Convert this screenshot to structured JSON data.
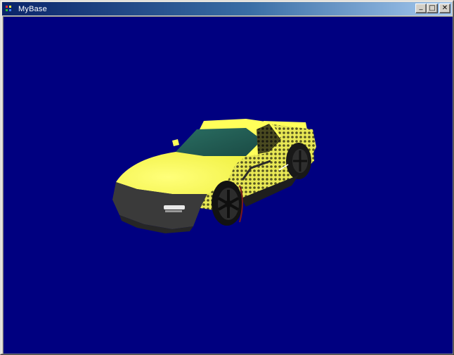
{
  "window": {
    "title": "MyBase",
    "controls": {
      "minimize": "_",
      "maximize": "□",
      "close": "✕"
    }
  },
  "icons": {
    "app": "directx-app-icon",
    "minimize": "minimize-icon",
    "maximize": "maximize-icon",
    "close": "close-icon"
  },
  "scene": {
    "background_color": "#000080",
    "car_body_color": "#ffff5a",
    "car_shade_color": "#3a3a3a",
    "glass_color": "#1e5a4e"
  }
}
